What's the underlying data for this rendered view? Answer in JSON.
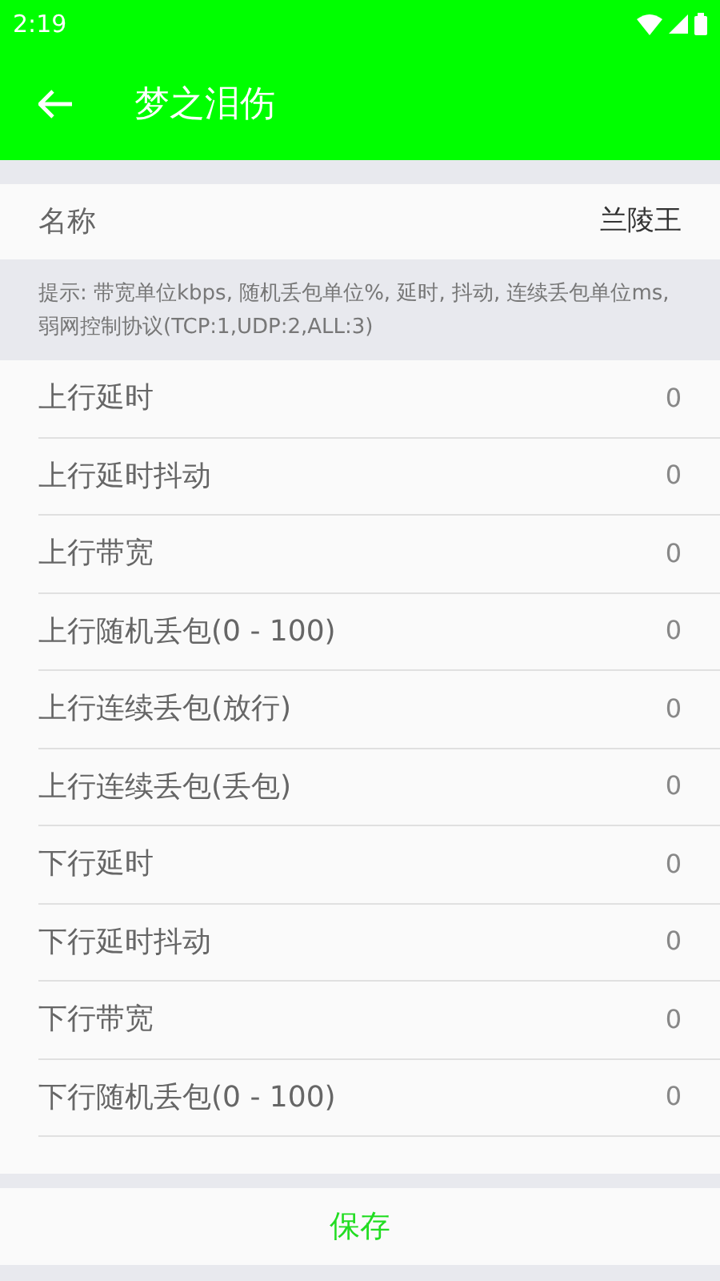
{
  "status_bar": {
    "time": "2:19"
  },
  "app_bar": {
    "title": "梦之泪伤"
  },
  "name_row": {
    "label": "名称",
    "value": "兰陵王"
  },
  "hint": "提示: 带宽单位kbps, 随机丢包单位%, 延时, 抖动, 连续丢包单位ms, 弱网控制协议(TCP:1,UDP:2,ALL:3)",
  "settings": [
    {
      "label": "上行延时",
      "value": "0"
    },
    {
      "label": "上行延时抖动",
      "value": "0"
    },
    {
      "label": "上行带宽",
      "value": "0"
    },
    {
      "label": "上行随机丢包(0 - 100)",
      "value": "0"
    },
    {
      "label": "上行连续丢包(放行)",
      "value": "0"
    },
    {
      "label": "上行连续丢包(丢包)",
      "value": "0"
    },
    {
      "label": "下行延时",
      "value": "0"
    },
    {
      "label": "下行延时抖动",
      "value": "0"
    },
    {
      "label": "下行带宽",
      "value": "0"
    },
    {
      "label": "下行随机丢包(0 - 100)",
      "value": "0"
    }
  ],
  "save_button": "保存"
}
